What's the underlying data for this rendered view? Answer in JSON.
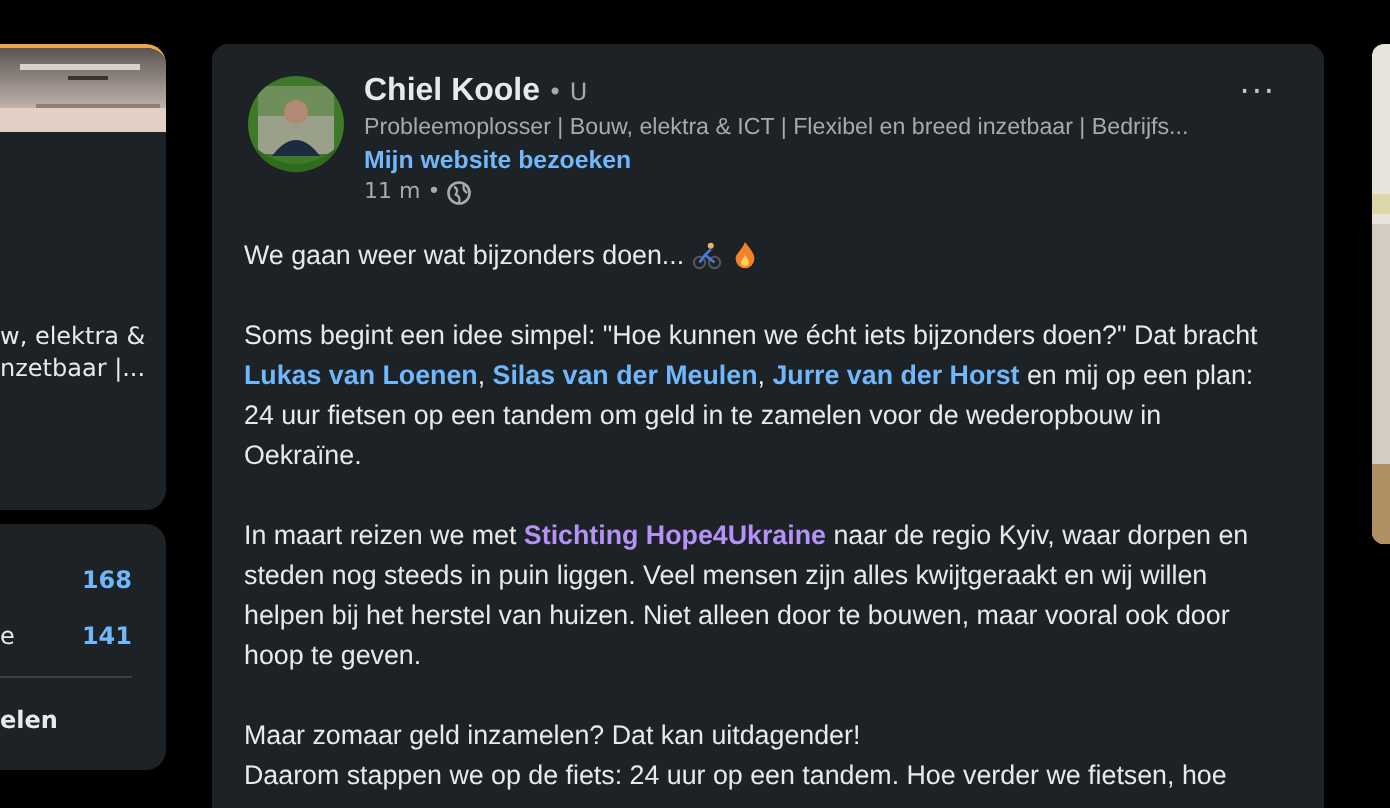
{
  "left_profile": {
    "headline_lines": [
      "w, elektra &",
      "nzetbaar |..."
    ]
  },
  "left_stats": {
    "rows": [
      {
        "label": "",
        "count": "168"
      },
      {
        "label": "e",
        "count": "141"
      }
    ],
    "footer": "elen"
  },
  "post": {
    "author": "Chiel Koole",
    "degree": "• U",
    "headline": "Probleemoplosser | Bouw, elektra & ICT | Flexibel en breed inzetbaar | Bedrijfs...",
    "website_link": "Mijn website bezoeken",
    "time": "11 m •",
    "menu": "···",
    "paragraphs": [
      {
        "segments": [
          {
            "kind": "text",
            "text": "We gaan weer wat bijzonders doen... "
          }
        ]
      },
      {
        "segments": [
          {
            "kind": "text",
            "text": "Soms begint een idee simpel: \"Hoe kunnen we écht iets bijzonders doen?\" Dat bracht "
          },
          {
            "kind": "person",
            "text": "Lukas van Loenen"
          },
          {
            "kind": "text",
            "text": ", "
          },
          {
            "kind": "person",
            "text": "Silas van der Meulen"
          },
          {
            "kind": "text",
            "text": ", "
          },
          {
            "kind": "person",
            "text": "Jurre van der Horst"
          },
          {
            "kind": "text",
            "text": " en mij op een plan: 24 uur fietsen op een tandem om geld in te zamelen voor de wederopbouw in Oekraïne."
          }
        ]
      },
      {
        "segments": [
          {
            "kind": "text",
            "text": "In maart reizen we met "
          },
          {
            "kind": "company",
            "text": "Stichting Hope4Ukraine"
          },
          {
            "kind": "text",
            "text": " naar de regio Kyiv, waar dorpen en steden nog steeds in puin liggen. Veel mensen zijn alles kwijtgeraakt en wij willen helpen bij het herstel van huizen. Niet alleen door te bouwen, maar vooral ook door hoop te geven."
          }
        ]
      },
      {
        "segments": [
          {
            "kind": "text",
            "text": "Maar zomaar geld inzamelen? Dat kan uitdagender!"
          },
          {
            "kind": "linebreak"
          },
          {
            "kind": "text",
            "text": "Daarom stappen we op de fiets: 24 uur op een tandem. Hoe verder we fietsen, hoe"
          }
        ]
      }
    ]
  }
}
